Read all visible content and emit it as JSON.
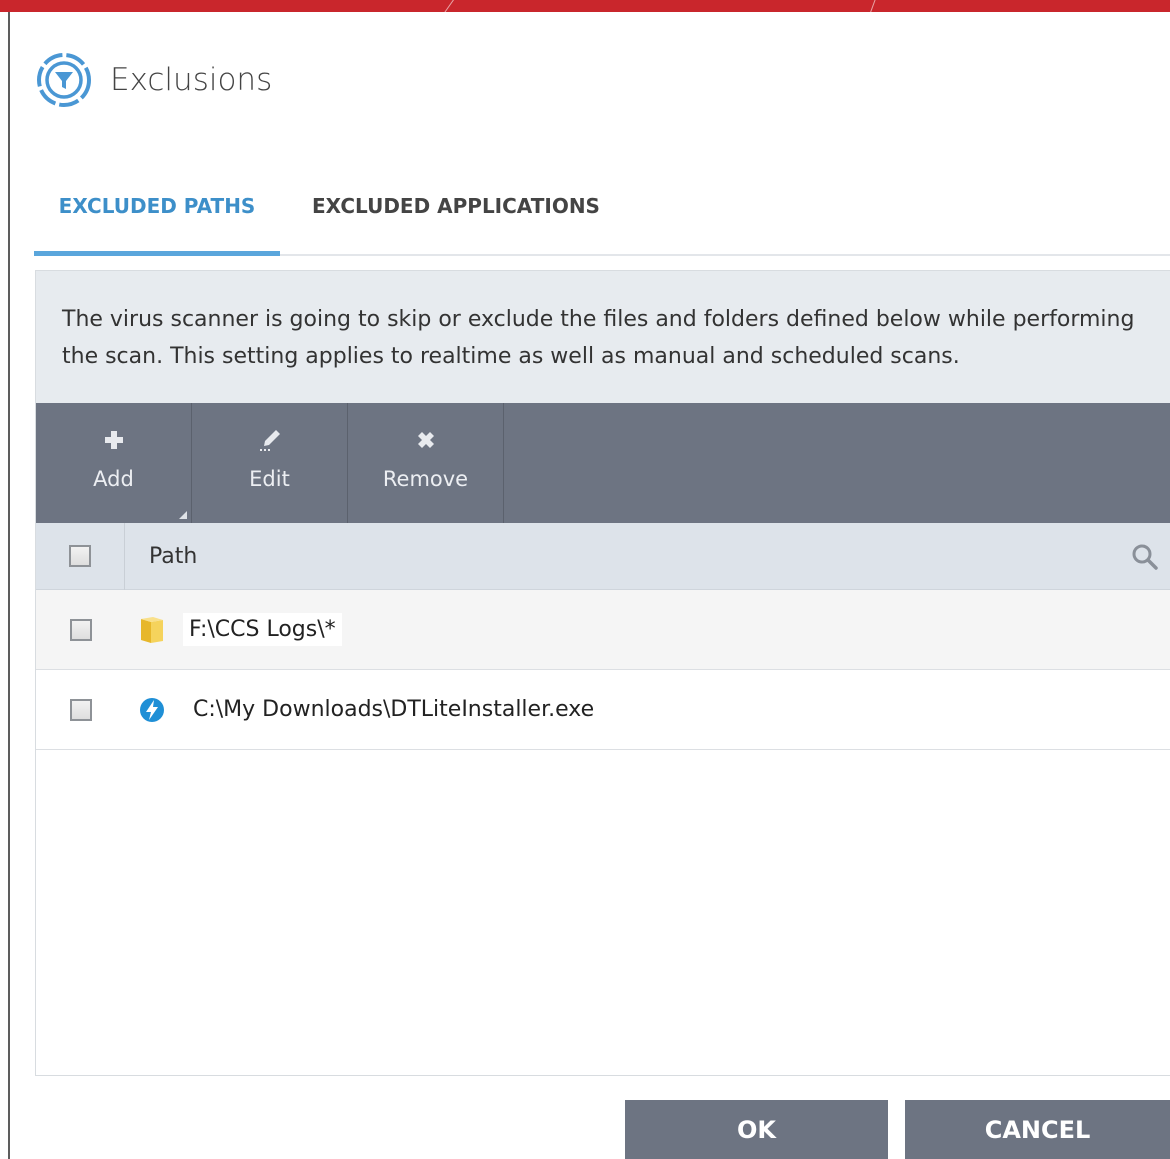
{
  "window": {
    "title": "Exclusions"
  },
  "tabs": [
    {
      "label": "EXCLUDED PATHS",
      "active": true
    },
    {
      "label": "EXCLUDED APPLICATIONS",
      "active": false
    }
  ],
  "description": "The virus scanner is going to skip or exclude the files and folders defined below while performing the scan. This setting applies to realtime as well as manual and scheduled scans.",
  "toolbar": {
    "add_label": "Add",
    "edit_label": "Edit",
    "remove_label": "Remove"
  },
  "table": {
    "columns": [
      "Path"
    ],
    "rows": [
      {
        "path": "F:\\CCS Logs\\*",
        "icon": "folder-icon",
        "checked": false
      },
      {
        "path": "C:\\My Downloads\\DTLiteInstaller.exe",
        "icon": "daemon-tools-icon",
        "checked": false
      }
    ]
  },
  "buttons": {
    "ok": "OK",
    "cancel": "CANCEL"
  },
  "colors": {
    "accent": "#3d8fc9",
    "toolbar": "#6d7482",
    "brand_bar": "#c9262c"
  }
}
